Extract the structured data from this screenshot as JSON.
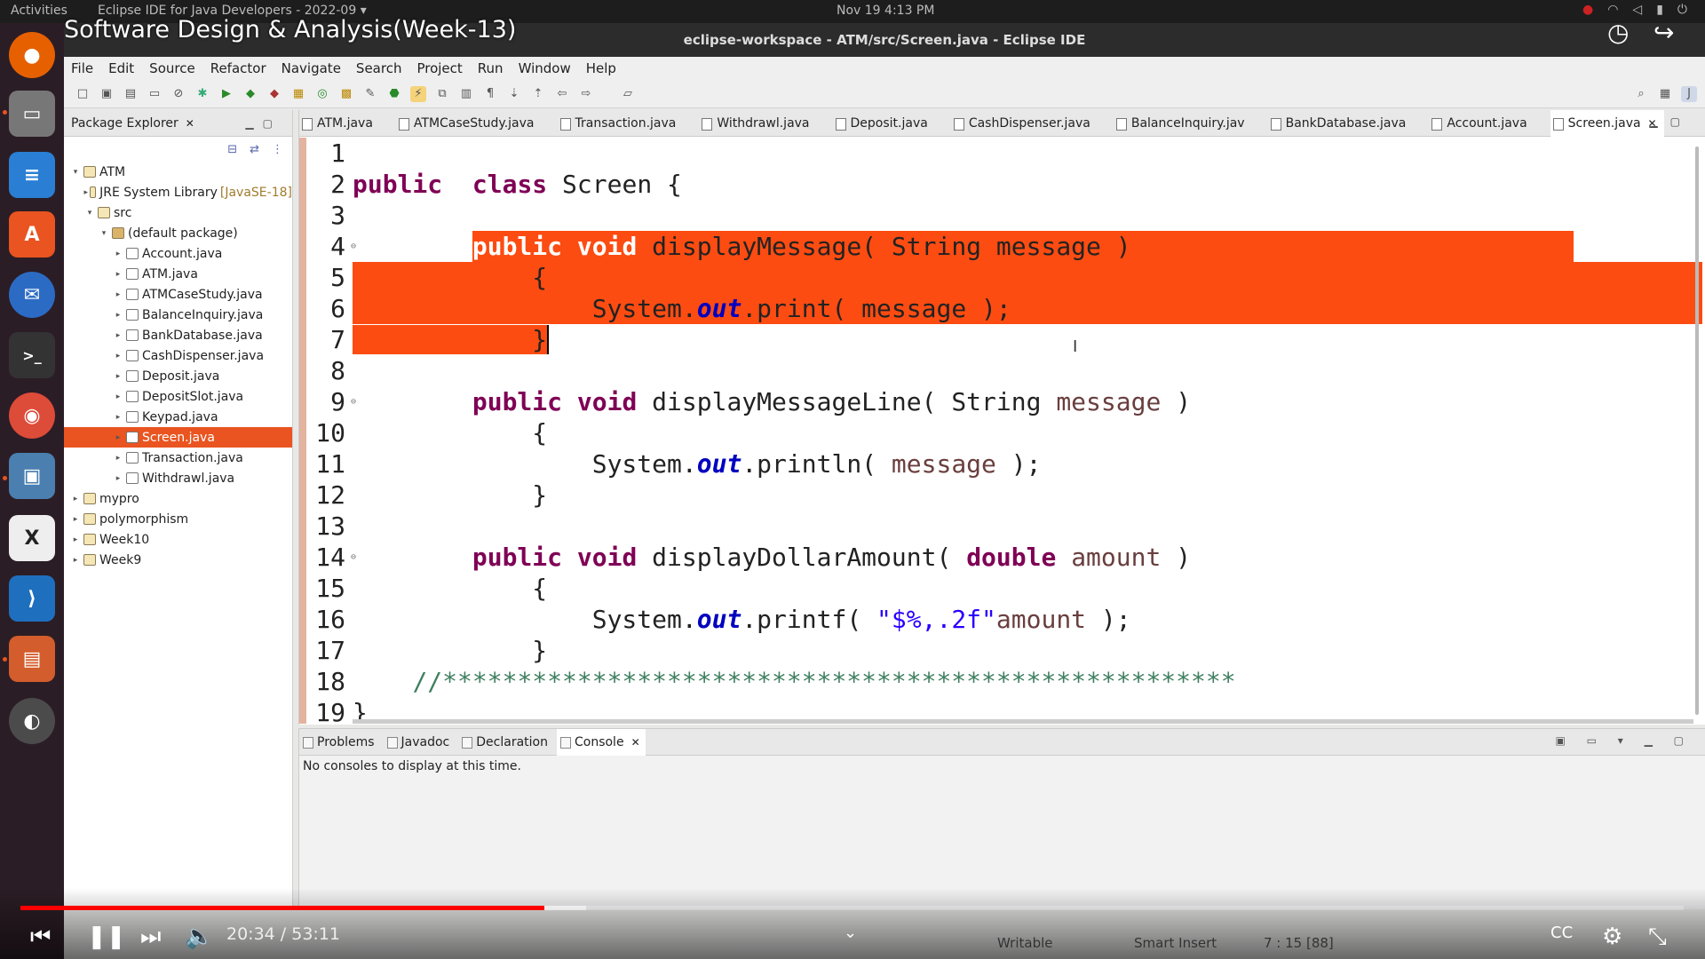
{
  "topbar": {
    "activities": "Activities",
    "app": "Eclipse IDE for Java Developers - 2022-09 ▾",
    "clock": "Nov 19  4:13 PM"
  },
  "video": {
    "title": "Software Design & Analysis(Week-13)",
    "time": "20:34 / 53:11",
    "progress": 0.315,
    "buffered": 0.34
  },
  "window": {
    "title": "eclipse-workspace - ATM/src/Screen.java - Eclipse IDE"
  },
  "menu": [
    "File",
    "Edit",
    "Source",
    "Refactor",
    "Navigate",
    "Search",
    "Project",
    "Run",
    "Window",
    "Help"
  ],
  "package_explorer": {
    "title": "Package Explorer",
    "tree": [
      {
        "label": "ATM",
        "depth": 0,
        "tw": "▾",
        "icon": "project"
      },
      {
        "label": "JRE System Library",
        "dec": "[JavaSE-18]",
        "depth": 1,
        "tw": "▸",
        "icon": "library"
      },
      {
        "label": "src",
        "depth": 1,
        "tw": "▾",
        "icon": "folder"
      },
      {
        "label": "(default package)",
        "depth": 2,
        "tw": "▾",
        "icon": "package"
      },
      {
        "label": "Account.java",
        "depth": 3,
        "tw": "▸",
        "icon": "file"
      },
      {
        "label": "ATM.java",
        "depth": 3,
        "tw": "▸",
        "icon": "file"
      },
      {
        "label": "ATMCaseStudy.java",
        "depth": 3,
        "tw": "▸",
        "icon": "file"
      },
      {
        "label": "BalanceInquiry.java",
        "depth": 3,
        "tw": "▸",
        "icon": "file"
      },
      {
        "label": "BankDatabase.java",
        "depth": 3,
        "tw": "▸",
        "icon": "file"
      },
      {
        "label": "CashDispenser.java",
        "depth": 3,
        "tw": "▸",
        "icon": "file"
      },
      {
        "label": "Deposit.java",
        "depth": 3,
        "tw": "▸",
        "icon": "file"
      },
      {
        "label": "DepositSlot.java",
        "depth": 3,
        "tw": "▸",
        "icon": "file"
      },
      {
        "label": "Keypad.java",
        "depth": 3,
        "tw": "▸",
        "icon": "file"
      },
      {
        "label": "Screen.java",
        "depth": 3,
        "tw": "▸",
        "icon": "file",
        "selected": true
      },
      {
        "label": "Transaction.java",
        "depth": 3,
        "tw": "▸",
        "icon": "file"
      },
      {
        "label": "Withdrawl.java",
        "depth": 3,
        "tw": "▸",
        "icon": "file"
      },
      {
        "label": "mypro",
        "depth": 0,
        "tw": "▸",
        "icon": "project"
      },
      {
        "label": "polymorphism",
        "depth": 0,
        "tw": "▸",
        "icon": "project"
      },
      {
        "label": "Week10",
        "depth": 0,
        "tw": "▸",
        "icon": "project"
      },
      {
        "label": "Week9",
        "depth": 0,
        "tw": "▸",
        "icon": "project"
      }
    ]
  },
  "editor_tabs": [
    "ATM.java",
    "ATMCaseStudy.java",
    "Transaction.java",
    "Withdrawl.java",
    "Deposit.java",
    "CashDispenser.java",
    "BalanceInquiry.jav",
    "BankDatabase.java",
    "Account.java",
    "Screen.java"
  ],
  "active_tab": "Screen.java",
  "code_lines": [
    {
      "n": "1",
      "tokens": []
    },
    {
      "n": "2",
      "tokens": [
        [
          "k",
          "public"
        ],
        [
          "",
          "  "
        ],
        [
          "k",
          "class"
        ],
        [
          "",
          " Screen {"
        ]
      ]
    },
    {
      "n": "3",
      "tokens": []
    },
    {
      "n": "4",
      "fold": true,
      "hl": "partial",
      "tokens": [
        [
          "",
          "        "
        ],
        [
          "k",
          "public"
        ],
        [
          "",
          " "
        ],
        [
          "k",
          "void"
        ],
        [
          "",
          " displayMessage( String message )"
        ]
      ]
    },
    {
      "n": "5",
      "hl": "full",
      "tokens": [
        [
          "",
          "            {"
        ]
      ]
    },
    {
      "n": "6",
      "hl": "full",
      "tokens": [
        [
          "",
          "                System."
        ],
        [
          "f",
          "out"
        ],
        [
          "",
          ".print( message );"
        ]
      ]
    },
    {
      "n": "7",
      "hl": "end",
      "tokens": [
        [
          "",
          "            }"
        ]
      ]
    },
    {
      "n": "8",
      "tokens": []
    },
    {
      "n": "9",
      "fold": true,
      "tokens": [
        [
          "",
          "        "
        ],
        [
          "k",
          "public"
        ],
        [
          "",
          " "
        ],
        [
          "k",
          "void"
        ],
        [
          "",
          " displayMessageLine( String "
        ],
        [
          "v",
          "message"
        ],
        [
          "",
          " )"
        ]
      ]
    },
    {
      "n": "10",
      "tokens": [
        [
          "",
          "            {"
        ]
      ]
    },
    {
      "n": "11",
      "tokens": [
        [
          "",
          "                System."
        ],
        [
          "f",
          "out"
        ],
        [
          "",
          ".println( "
        ],
        [
          "v",
          "message"
        ],
        [
          "",
          " );"
        ]
      ]
    },
    {
      "n": "12",
      "tokens": [
        [
          "",
          "            }"
        ]
      ]
    },
    {
      "n": "13",
      "tokens": []
    },
    {
      "n": "14",
      "fold": true,
      "tokens": [
        [
          "",
          "        "
        ],
        [
          "k",
          "public"
        ],
        [
          "",
          " "
        ],
        [
          "k",
          "void"
        ],
        [
          "",
          " displayDollarAmount( "
        ],
        [
          "k",
          "double"
        ],
        [
          "",
          " "
        ],
        [
          "v",
          "amount"
        ],
        [
          "",
          " )"
        ]
      ]
    },
    {
      "n": "15",
      "tokens": [
        [
          "",
          "            {"
        ]
      ]
    },
    {
      "n": "16",
      "tokens": [
        [
          "",
          "                System."
        ],
        [
          "f",
          "out"
        ],
        [
          "",
          ".printf( "
        ],
        [
          "s",
          "\"$%,.2f\""
        ],
        [
          ", "
        ],
        [
          "v",
          "amount"
        ],
        [
          "",
          " );"
        ]
      ]
    },
    {
      "n": "17",
      "tokens": [
        [
          "",
          "            }"
        ]
      ]
    },
    {
      "n": "18",
      "tokens": [
        [
          "",
          "    "
        ],
        [
          "c",
          "//*****************************************************"
        ]
      ]
    },
    {
      "n": "19",
      "tokens": [
        [
          "",
          "}"
        ]
      ]
    }
  ],
  "console": {
    "tabs": [
      "Problems",
      "Javadoc",
      "Declaration",
      "Console"
    ],
    "active": "Console",
    "message": "No consoles to display at this time."
  },
  "status": {
    "writable": "Writable",
    "insert": "Smart Insert",
    "position": "7 : 15 [88]"
  },
  "colors": {
    "accent": "#e95420",
    "selection": "#fc4c12",
    "progress": "#ff0000"
  }
}
